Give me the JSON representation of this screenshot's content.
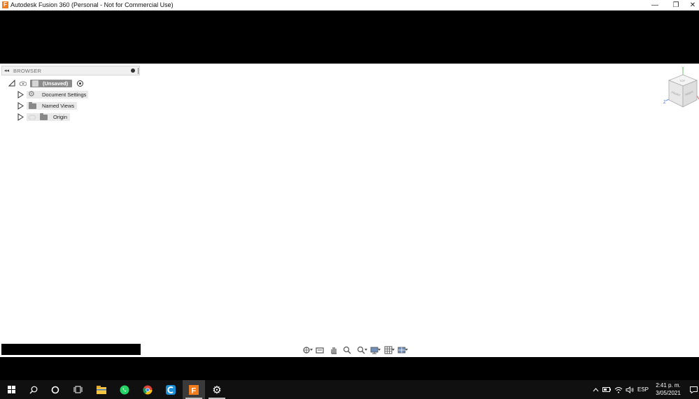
{
  "window": {
    "title": "Autodesk Fusion 360 (Personal - Not for Commercial Use)",
    "app_icon_letter": "F",
    "minimize_glyph": "—",
    "maximize_glyph": "❐",
    "close_glyph": "✕"
  },
  "browser": {
    "title": "BROWSER",
    "root": {
      "label": "(Unsaved)"
    },
    "items": [
      {
        "label": "Document Settings",
        "icon": "gear-icon"
      },
      {
        "label": "Named Views",
        "icon": "folder-icon"
      },
      {
        "label": "Origin",
        "icon": "folder-icon"
      }
    ]
  },
  "viewcube": {
    "top_label": "TOP",
    "front_label": "FRONT",
    "right_label": "RIGHT",
    "axis_y": "Y",
    "axis_z": "Z"
  },
  "nav_toolbar": [
    "orbit-icon",
    "look-at-icon",
    "pan-icon",
    "zoom-icon",
    "fit-icon",
    "display-settings-icon",
    "grid-icon",
    "viewports-icon"
  ],
  "taskbar": {
    "language": "ESP",
    "time": "2:41 p. m.",
    "date": "3/05/2021"
  },
  "colors": {
    "accent": "#f07c1e",
    "taskbar": "#101010",
    "panel_header": "#f0f0f0"
  }
}
